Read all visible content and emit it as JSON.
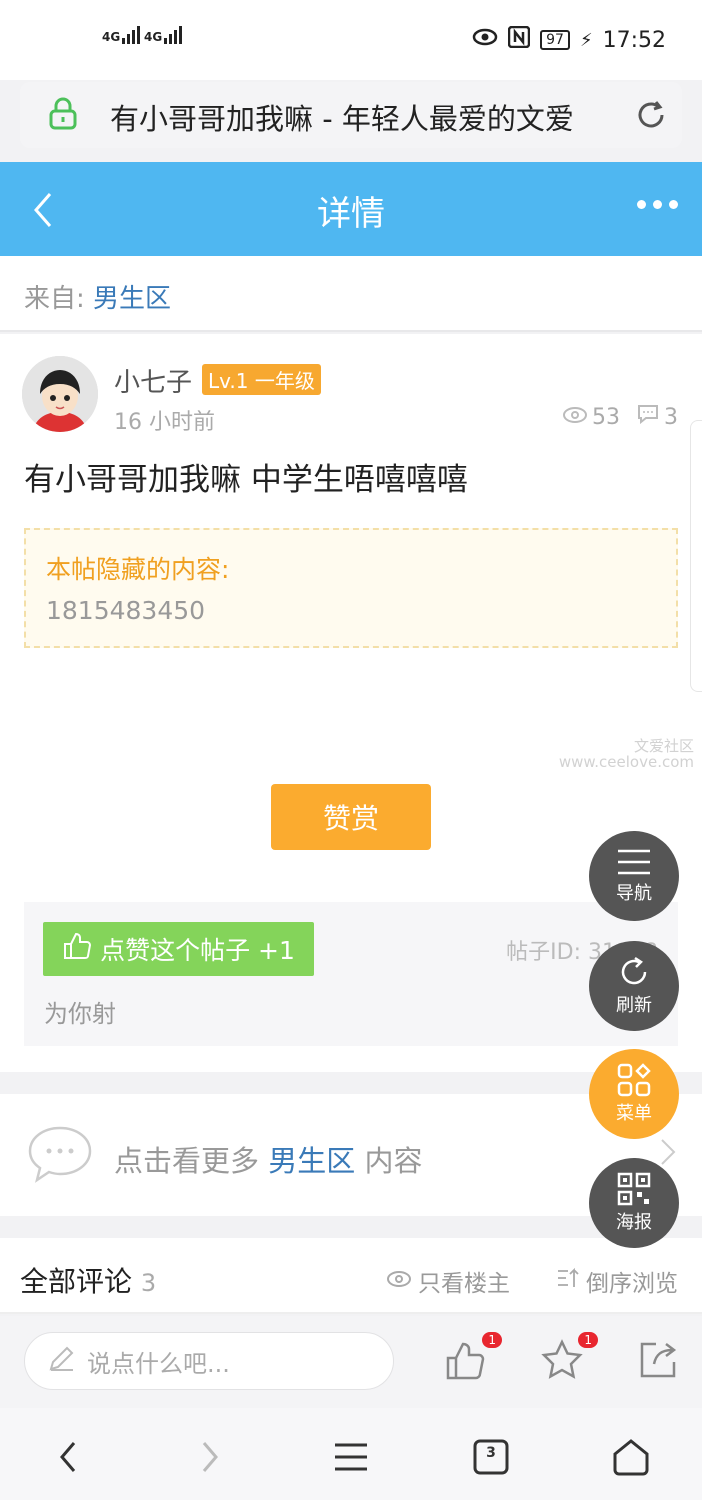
{
  "status_bar": {
    "signal_1": "4G",
    "signal_2": "4G",
    "battery": "97",
    "time": "17:52"
  },
  "browser": {
    "title": "有小哥哥加我嘛 - 年轻人最爱的文爱"
  },
  "header": {
    "title": "详情"
  },
  "source": {
    "prefix": "来自:",
    "section": "男生区"
  },
  "post": {
    "author": "小七子",
    "level": "Lv.1 一年级",
    "time": "16 小时前",
    "views": "53",
    "comments": "3",
    "title": "有小哥哥加我嘛 中学生唔嘻嘻嘻",
    "hidden_label": "本帖隐藏的内容:",
    "hidden_content": "1815483450",
    "watermark_line1": "文爱社区",
    "watermark_line2": "www.ceelove.com",
    "reward_label": "赞赏",
    "like_label": "点赞这个帖子 +1",
    "post_id_label": "帖子ID: 31158",
    "signature": "为你射"
  },
  "more_row": {
    "prefix": "点击看更多",
    "section": "男生区",
    "suffix": "内容"
  },
  "comments": {
    "title": "全部评论",
    "count": "3",
    "only_op": "只看楼主",
    "reverse": "倒序浏览"
  },
  "compose": {
    "placeholder": "说点什么吧...",
    "like_badge": "1",
    "fav_badge": "1"
  },
  "fabs": {
    "nav": "导航",
    "refresh": "刷新",
    "menu": "菜单",
    "poster": "海报"
  },
  "bottom_nav": {
    "tabs_count": "3"
  }
}
